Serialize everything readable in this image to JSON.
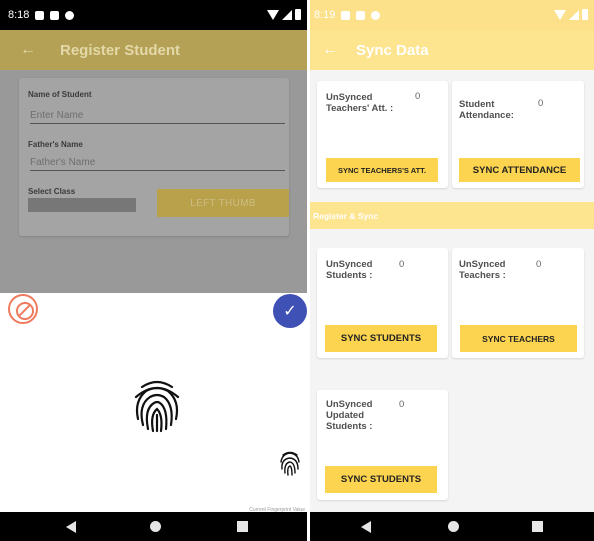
{
  "left_screen": {
    "status_bar": {
      "time": "8:18"
    },
    "app_bar": {
      "back": "←",
      "title": "Register Student"
    },
    "form": {
      "name_label": "Name of Student",
      "name_placeholder": "Enter Name",
      "father_label": "Father's Name",
      "father_placeholder": "Father's Name",
      "class_label": "Select Class",
      "thumb_button": "LEFT THUMB"
    },
    "fingerprint_dialog": {
      "confirm_glyph": "✓",
      "caption": "Current Fingerprint Value"
    }
  },
  "right_screen": {
    "status_bar": {
      "time": "8:19"
    },
    "app_bar": {
      "back": "←",
      "title": "Sync Data"
    },
    "section_label": "Register & Sync",
    "cards": [
      {
        "label_lines": [
          "UnSynced",
          "Teachers' Att. :"
        ],
        "count": "0",
        "button": "SYNC TEACHERS'S ATT."
      },
      {
        "label_lines": [
          "Student",
          "Attendance:"
        ],
        "count": "0",
        "button": "SYNC ATTENDANCE"
      },
      {
        "label_lines": [
          "UnSynced",
          "Students :"
        ],
        "count": "0",
        "button": "SYNC STUDENTS"
      },
      {
        "label_lines": [
          "UnSynced",
          "Teachers :"
        ],
        "count": "0",
        "button": "SYNC TEACHERS"
      },
      {
        "label_lines": [
          "UnSynced",
          "Updated",
          "Students :"
        ],
        "count": "0",
        "button": "SYNC STUDENTS"
      }
    ]
  },
  "icons": {
    "cancel": "cancel-icon",
    "confirm": "check-icon",
    "fingerprint": "fingerprint-icon",
    "nav_back": "nav-back-icon",
    "nav_home": "nav-home-icon",
    "nav_recent": "nav-recent-icon"
  },
  "colors": {
    "accent_yellow": "#fcd44f",
    "appbar_yellow": "#fde48f",
    "confirm_blue": "#3f51b5",
    "cancel_orange": "#ef7a5d"
  }
}
